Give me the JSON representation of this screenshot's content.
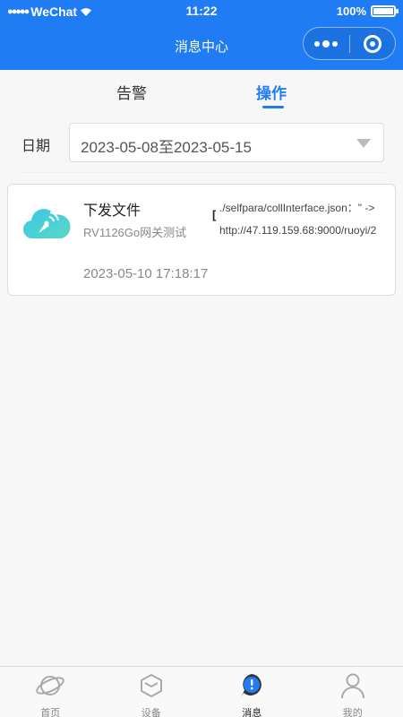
{
  "status_bar": {
    "carrier": "WeChat",
    "time": "11:22",
    "battery": "100%"
  },
  "nav": {
    "title": "消息中心"
  },
  "tabs": [
    {
      "label": "告警",
      "active": false
    },
    {
      "label": "操作",
      "active": true
    }
  ],
  "filter": {
    "date_label": "日期",
    "date_range": "2023-05-08至2023-05-15"
  },
  "messages": [
    {
      "title": "下发文件",
      "device": "RV1126Go网关测试",
      "bracket": "[",
      "detail_line1": "./selfpara/collInterface.json：\" ->",
      "detail_line2": "http://47.119.159.68:9000/ruoyi/2",
      "time": "2023-05-10 17:18:17",
      "icon": "cloud-antenna-icon"
    }
  ],
  "tabbar": [
    {
      "label": "首页",
      "icon": "planet-icon",
      "active": false
    },
    {
      "label": "设备",
      "icon": "cube-icon",
      "active": false
    },
    {
      "label": "消息",
      "icon": "message-icon",
      "active": true
    },
    {
      "label": "我的",
      "icon": "user-icon",
      "active": false
    }
  ],
  "colors": {
    "brand": "#1f7cf5",
    "cloud_gradient_start": "#3cc6e8",
    "cloud_gradient_end": "#5ad8c4"
  }
}
